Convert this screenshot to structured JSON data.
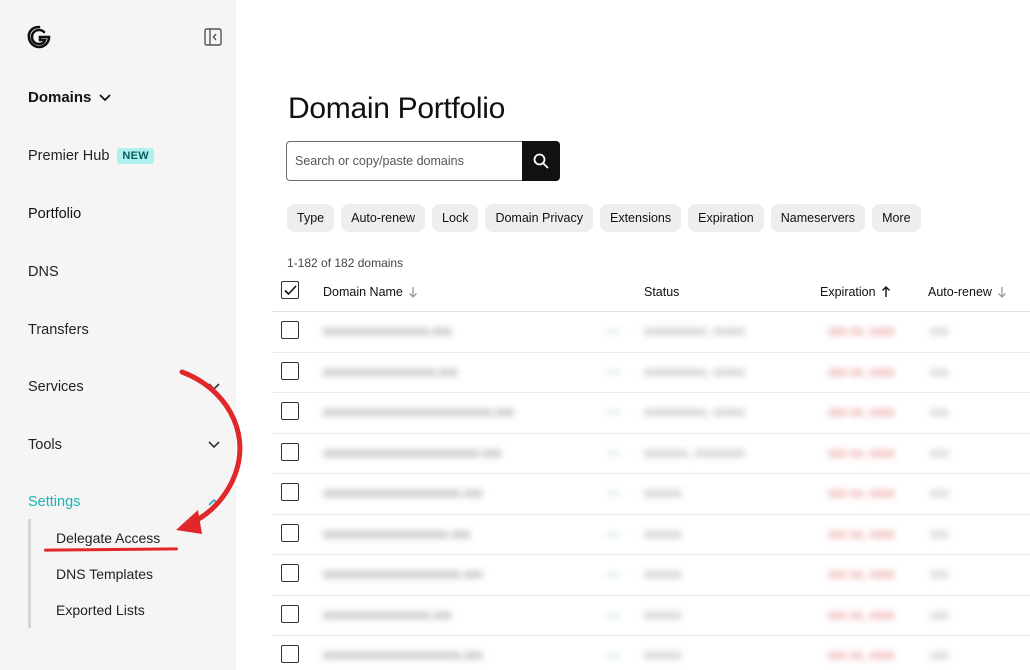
{
  "sidebar": {
    "domains_label": "Domains",
    "premier_label": "Premier Hub",
    "premier_badge": "NEW",
    "portfolio_label": "Portfolio",
    "dns_label": "DNS",
    "transfers_label": "Transfers",
    "services_label": "Services",
    "tools_label": "Tools",
    "settings_label": "Settings",
    "settings_items": [
      "Delegate Access",
      "DNS Templates",
      "Exported Lists"
    ],
    "settings_color": "#1fb3b8",
    "badge_color": "#aef2f0"
  },
  "main": {
    "title": "Domain Portfolio",
    "search_placeholder": "Search or copy/paste domains",
    "filters": [
      "Type",
      "Auto-renew",
      "Lock",
      "Domain Privacy",
      "Extensions",
      "Expiration",
      "Nameservers",
      "More"
    ],
    "count_text": "1-182 of 182 domains",
    "columns": {
      "name": "Domain Name",
      "status": "Status",
      "expiration": "Expiration",
      "autorenew": "Auto-renew"
    }
  },
  "annotation": {
    "arrow_color": "#e0282a"
  }
}
